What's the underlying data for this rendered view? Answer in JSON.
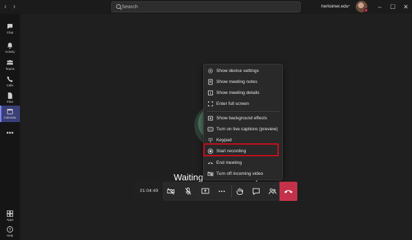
{
  "titlebar": {
    "search_placeholder": "Search",
    "account": "herloimer.edu",
    "back_icon": "chevron-left-icon",
    "forward_icon": "chevron-right-icon"
  },
  "rail": {
    "items": [
      {
        "label": "Chat",
        "icon": "chat-icon"
      },
      {
        "label": "Activity",
        "icon": "bell-icon"
      },
      {
        "label": "Teams",
        "icon": "teams-icon"
      },
      {
        "label": "Calls",
        "icon": "phone-icon"
      },
      {
        "label": "Files",
        "icon": "file-icon"
      },
      {
        "label": "Calendar",
        "icon": "calendar-icon",
        "active": true
      }
    ],
    "more": "•••",
    "bottom": [
      {
        "label": "Apps",
        "icon": "apps-icon"
      },
      {
        "label": "Help",
        "icon": "help-icon"
      }
    ]
  },
  "stage": {
    "waiting_text": "Waiting for others to join..."
  },
  "menu": {
    "items": [
      {
        "label": "Show device settings",
        "icon": "gear-icon"
      },
      {
        "label": "Show meeting notes",
        "icon": "notes-icon"
      },
      {
        "label": "Show meeting details",
        "icon": "info-icon"
      },
      {
        "label": "Enter full screen",
        "icon": "fullscreen-icon"
      },
      {
        "label": "Show background effects",
        "icon": "background-effects-icon"
      },
      {
        "label": "Turn on live captions (preview)",
        "icon": "captions-icon"
      },
      {
        "label": "Keypad",
        "icon": "keypad-icon"
      },
      {
        "label": "Start recording",
        "icon": "record-icon"
      },
      {
        "label": "End meeting",
        "icon": "end-meeting-icon"
      },
      {
        "label": "Turn off incoming video",
        "icon": "video-off-icon"
      }
    ],
    "highlighted": "Start recording"
  },
  "callbar": {
    "timer": "01:04:49",
    "buttons": [
      "camera-off-icon",
      "mic-off-icon",
      "share-screen-icon",
      "more-options-icon",
      "raise-hand-icon",
      "chat-bubble-icon",
      "participants-icon",
      "hang-up-icon"
    ]
  },
  "colors": {
    "background": "#1f1f1f",
    "rail": "#151515",
    "accent": "#7f85f5",
    "hangup": "#c4314b",
    "highlight_border": "#c50f1f"
  }
}
